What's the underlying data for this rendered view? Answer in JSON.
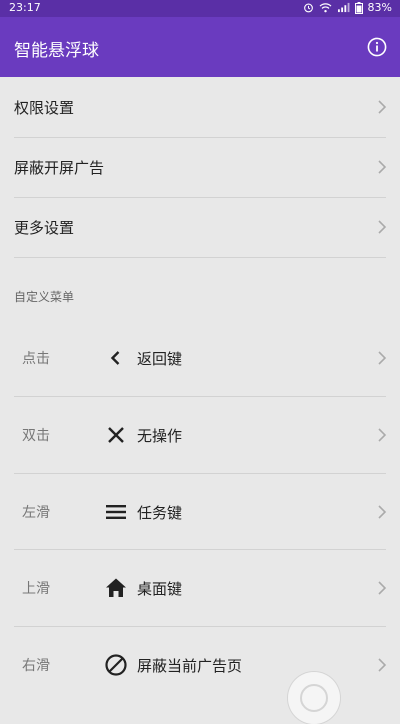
{
  "status_bar": {
    "time": "23:17",
    "battery": "83%",
    "icons": [
      "alarm-icon",
      "wifi-icon",
      "signal-icon",
      "battery-icon"
    ]
  },
  "app_bar": {
    "title": "智能悬浮球",
    "icon": "info-icon"
  },
  "settings": [
    {
      "label": "权限设置"
    },
    {
      "label": "屏蔽开屏广告"
    },
    {
      "label": "更多设置"
    }
  ],
  "custom_menu": {
    "title": "自定义菜单",
    "items": [
      {
        "gesture": "点击",
        "icon": "back-arrow-icon",
        "action": "返回键"
      },
      {
        "gesture": "双击",
        "icon": "close-icon",
        "action": "无操作"
      },
      {
        "gesture": "左滑",
        "icon": "menu-icon",
        "action": "任务键"
      },
      {
        "gesture": "上滑",
        "icon": "home-icon",
        "action": "桌面键"
      },
      {
        "gesture": "右滑",
        "icon": "block-icon",
        "action": "屏蔽当前广告页"
      }
    ]
  },
  "colors": {
    "status_bar": "#5a2fa6",
    "app_bar": "#6a3bbf",
    "background": "#e8e8e8"
  }
}
